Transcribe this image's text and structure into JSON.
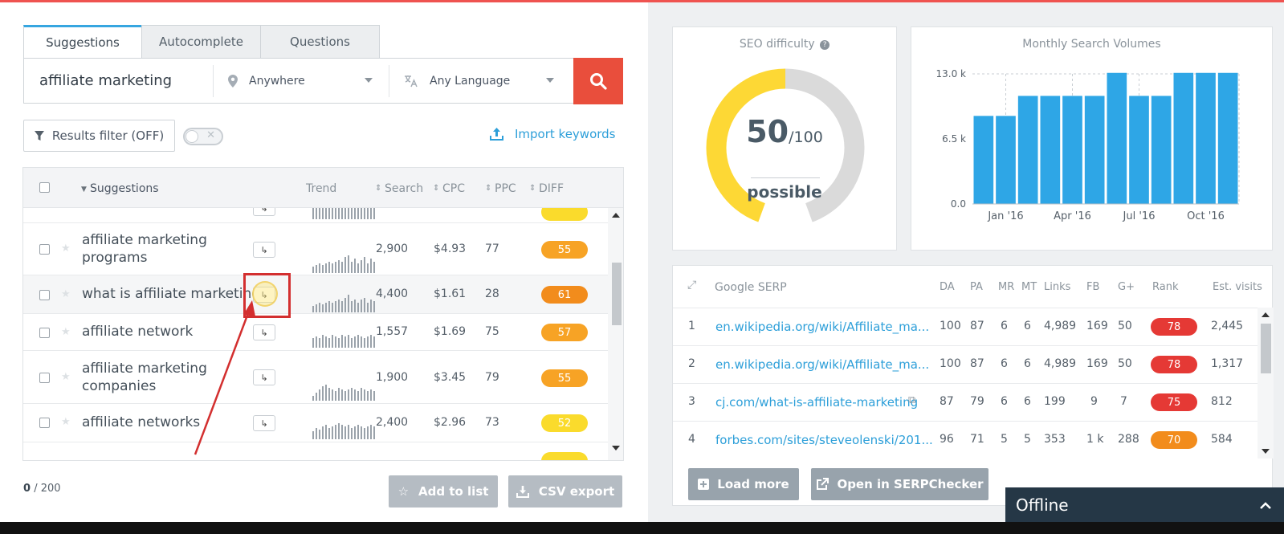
{
  "tabs": [
    {
      "label": "Suggestions",
      "active": true
    },
    {
      "label": "Autocomplete",
      "active": false
    },
    {
      "label": "Questions",
      "active": false
    }
  ],
  "search": {
    "query": "affiliate marketing",
    "location": "Anywhere",
    "language": "Any Language"
  },
  "filter": {
    "label": "Results filter (OFF)",
    "import_label": "Import keywords"
  },
  "table": {
    "headers": {
      "suggestions": "Suggestions",
      "trend": "Trend",
      "search": "Search",
      "cpc": "CPC",
      "ppc": "PPC",
      "diff": "DIFF"
    },
    "rows": [
      {
        "keyword": "affiliate marketing programs",
        "search": "2,900",
        "cpc": "$4.93",
        "ppc": "77",
        "diff": "55",
        "diff_color": "#f7a325"
      },
      {
        "keyword": "what is affiliate marketing",
        "search": "4,400",
        "cpc": "$1.61",
        "ppc": "28",
        "diff": "61",
        "diff_color": "#f28c1c"
      },
      {
        "keyword": "affiliate network",
        "search": "1,557",
        "cpc": "$1.69",
        "ppc": "75",
        "diff": "57",
        "diff_color": "#f7a325"
      },
      {
        "keyword": "affiliate marketing companies",
        "search": "1,900",
        "cpc": "$3.45",
        "ppc": "79",
        "diff": "55",
        "diff_color": "#f7a325"
      },
      {
        "keyword": "affiliate networks",
        "search": "2,400",
        "cpc": "$2.96",
        "ppc": "73",
        "diff": "52",
        "diff_color": "#fadb2c"
      }
    ]
  },
  "footer": {
    "count_selected": "0",
    "count_total": "/ 200",
    "add_to_list": "Add to list",
    "csv_export": "CSV export"
  },
  "seo": {
    "title": "SEO difficulty",
    "value": "50",
    "of": "/100",
    "label": "possible",
    "fraction": 0.5,
    "fill_color": "#fdd835",
    "rest_color": "#dadada"
  },
  "msv": {
    "title": "Monthly Search Volumes"
  },
  "chart_data": {
    "type": "bar",
    "title": "Monthly Search Volumes",
    "x_tick_labels": [
      "Jan '16",
      "Apr '16",
      "Jul '16",
      "Oct '16"
    ],
    "y_tick_labels": [
      "13.0 k",
      "6.5 k",
      "0.0"
    ],
    "ylim": [
      0,
      13000
    ],
    "values": [
      8800,
      8800,
      10800,
      10800,
      10800,
      10800,
      13100,
      10800,
      10800,
      13100,
      13100,
      13100
    ],
    "bar_color": "#2ea6e6",
    "grid": true
  },
  "serp": {
    "headers": {
      "title": "Google SERP",
      "da": "DA",
      "pa": "PA",
      "mr": "MR",
      "mt": "MT",
      "links": "Links",
      "fb": "FB",
      "gplus": "G+",
      "rank": "Rank",
      "visits": "Est. visits"
    },
    "rows": [
      {
        "pos": "1",
        "url": "en.wikipedia.org/wiki/Affiliate_ma...",
        "da": "100",
        "pa": "87",
        "mr": "6",
        "mt": "6",
        "links": "4,989",
        "fb": "169",
        "gplus": "50",
        "rank": "78",
        "rank_color": "#e53935",
        "visits": "2,445"
      },
      {
        "pos": "2",
        "url": "en.wikipedia.org/wiki/Affiliate_ma...",
        "da": "100",
        "pa": "87",
        "mr": "6",
        "mt": "6",
        "links": "4,989",
        "fb": "169",
        "gplus": "50",
        "rank": "78",
        "rank_color": "#e53935",
        "visits": "1,317"
      },
      {
        "pos": "3",
        "url": "cj.com/what-is-affiliate-marketing",
        "da": "87",
        "pa": "79",
        "mr": "6",
        "mt": "6",
        "links": "199",
        "fb": "9",
        "gplus": "7",
        "rank": "75",
        "rank_color": "#e53935",
        "visits": "812"
      },
      {
        "pos": "4",
        "url": "forbes.com/sites/steveolenski/201...",
        "da": "96",
        "pa": "71",
        "mr": "5",
        "mt": "5",
        "links": "353",
        "fb": "1 k",
        "gplus": "288",
        "rank": "70",
        "rank_color": "#f28c1c",
        "visits": "584"
      }
    ],
    "load_more": "Load more",
    "open_serpchecker": "Open in SERPChecker"
  },
  "chat": {
    "status": "Offline"
  },
  "colors": {
    "accent": "#2d9fd9",
    "search_button": "#e94e3c",
    "highlight": "#d32f2f"
  },
  "icons": {
    "location": "map-pin-icon",
    "language": "translate-icon",
    "search": "search-icon",
    "filter": "funnel-icon",
    "import": "upload-icon",
    "star": "star-icon",
    "go": "forward-arrow-icon",
    "external": "external-link-icon"
  }
}
